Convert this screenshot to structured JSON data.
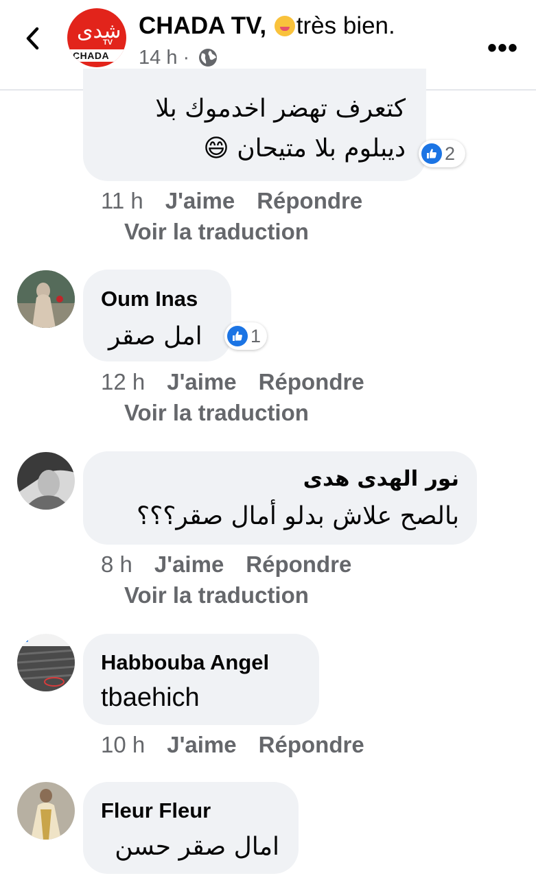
{
  "header": {
    "page_name": "CHADA TV,",
    "state_text": "très bien.",
    "time": "14 h",
    "separator": "·",
    "avatar_arabic": "شدى",
    "avatar_tv": "TV",
    "avatar_band": "CHADA",
    "more_label": "•••"
  },
  "comments": [
    {
      "author": "",
      "lines": [
        "كتعرف تهضر اخدموك بلا",
        "ديبلوم بلا متيحان 😄"
      ],
      "reaction_count": "2",
      "time": "11 h",
      "like_label": "J'aime",
      "reply_label": "Répondre",
      "translate_label": "Voir la traduction"
    },
    {
      "author": "Oum Inas",
      "lines": [
        "امل صقر"
      ],
      "reaction_count": "1",
      "time": "12 h",
      "like_label": "J'aime",
      "reply_label": "Répondre",
      "translate_label": "Voir la traduction"
    },
    {
      "author": "نور الهدى هدى",
      "lines": [
        "بالصح علاش بدلو أمال صقر؟؟؟"
      ],
      "time": "8 h",
      "like_label": "J'aime",
      "reply_label": "Répondre",
      "translate_label": "Voir la traduction"
    },
    {
      "author": "Habbouba Angel",
      "lines": [
        "tbaehich"
      ],
      "time": "10 h",
      "like_label": "J'aime",
      "reply_label": "Répondre"
    },
    {
      "author": "Fleur Fleur",
      "lines": [
        "امال صقر حسن"
      ]
    }
  ],
  "colors": {
    "bubble": "#f0f2f5",
    "meta_text": "#65676b",
    "like_blue": "#1b74e4",
    "brand_red": "#e2241b"
  }
}
